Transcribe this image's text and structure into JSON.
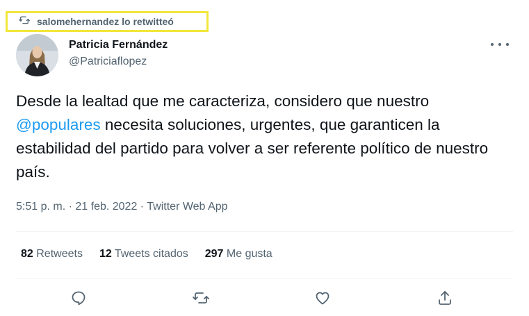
{
  "retweet": {
    "label": "salomehernandez lo retwitteó"
  },
  "author": {
    "name": "Patricia Fernández",
    "handle": "@Patriciaflopez"
  },
  "tweet": {
    "part1": "Desde la lealtad que me caracteriza, considero que nuestro ",
    "mention": "@populares",
    "part2": " necesita soluciones, urgentes, que garanticen la estabilidad del partido para volver a ser referente político de nuestro país."
  },
  "meta": {
    "time": "5:51 p. m.",
    "sep": " · ",
    "date": "21 feb. 2022",
    "sep2": " · ",
    "source": "Twitter Web App"
  },
  "stats": [
    {
      "count": "82",
      "label": "Retweets"
    },
    {
      "count": "12",
      "label": "Tweets citados"
    },
    {
      "count": "297",
      "label": "Me gusta"
    }
  ],
  "colors": {
    "accent": "#1d9bf0",
    "muted": "#536471",
    "highlight": "#f2e63a"
  },
  "icons": {
    "reply": "reply-icon",
    "retweet": "retweet-icon",
    "like": "heart-icon",
    "share": "share-icon",
    "more": "more-icon"
  }
}
